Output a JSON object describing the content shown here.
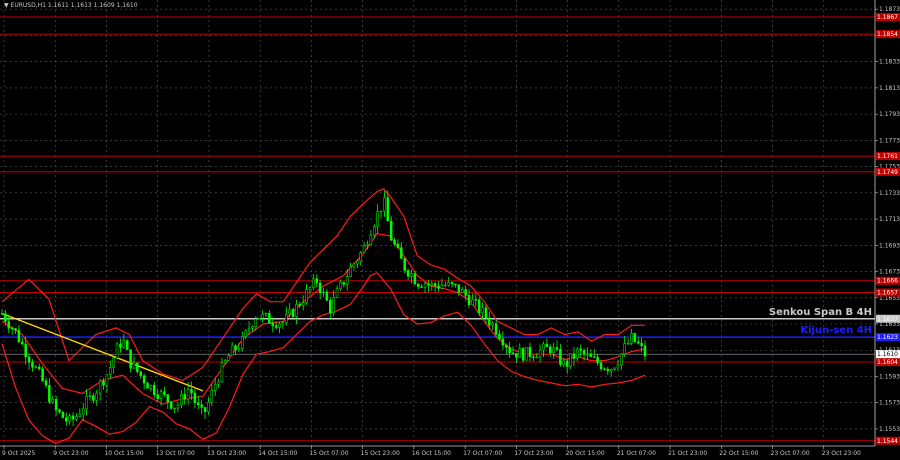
{
  "header": {
    "title": "▼ EURUSD,H1  1.1611 1.1613 1.1609 1.1610"
  },
  "colors": {
    "background": "#000000",
    "grid": "#5a5a5a",
    "candle": "#00ff00",
    "band": "#ff1a1a",
    "level": "#c00000",
    "senkou": "#c8c8c8",
    "kijun": "#1e1eff",
    "trend": "#ffd700",
    "price_line": "#c8c8c8"
  },
  "chart_data": {
    "type": "line",
    "symbol": "EURUSD",
    "timeframe": "H1",
    "ylim": [
      1.154,
      1.188
    ],
    "y_ticks": [
      "1.1873",
      "1.1853",
      "1.1833",
      "1.1813",
      "1.1793",
      "1.1773",
      "1.1753",
      "1.1733",
      "1.1713",
      "1.1693",
      "1.1673",
      "1.1653",
      "1.1633",
      "1.1613",
      "1.1593",
      "1.1573",
      "1.1553"
    ],
    "x_ticks": [
      "9 Oct 2025",
      "9 Oct 23:00",
      "10 Oct 15:00",
      "13 Oct 07:00",
      "13 Oct 23:00",
      "14 Oct 15:00",
      "15 Oct 07:00",
      "15 Oct 23:00",
      "16 Oct 15:00",
      "17 Oct 07:00",
      "17 Oct 23:00",
      "20 Oct 15:00",
      "21 Oct 07:00",
      "21 Oct 23:00",
      "22 Oct 15:00",
      "23 Oct 07:00",
      "23 Oct 23:00"
    ],
    "current_price": "1.1610",
    "legend": "none",
    "grid": true,
    "levels": [
      {
        "price": 1.1867,
        "label": "1.1867",
        "color": "#c00000"
      },
      {
        "price": 1.1854,
        "label": "1.1854",
        "color": "#c00000"
      },
      {
        "price": 1.1761,
        "label": "1.1761",
        "color": "#c00000"
      },
      {
        "price": 1.1749,
        "label": "1.1749",
        "color": "#c00000"
      },
      {
        "price": 1.1666,
        "label": "1.1666",
        "color": "#c00000"
      },
      {
        "price": 1.1657,
        "label": "1.1657",
        "color": "#c00000"
      },
      {
        "price": 1.1637,
        "label": "1.1637",
        "color": "#c8c8c8",
        "name": "Senkou Span B 4H"
      },
      {
        "price": 1.1623,
        "label": "1.1623",
        "color": "#1e1eff",
        "name": "Kijun-sen 4H"
      },
      {
        "price": 1.1604,
        "label": "1.1604",
        "color": "#c00000"
      },
      {
        "price": 1.1544,
        "label": "1.1544",
        "color": "#c00000"
      }
    ],
    "price_path": [
      [
        0,
        1.1641
      ],
      [
        2,
        1.1627
      ],
      [
        4,
        1.1608
      ],
      [
        6,
        1.159
      ],
      [
        8,
        1.1567
      ],
      [
        10,
        1.1558
      ],
      [
        11,
        1.1562
      ],
      [
        12,
        1.157
      ],
      [
        13,
        1.1575
      ],
      [
        14,
        1.1582
      ],
      [
        15,
        1.159
      ],
      [
        16,
        1.1598
      ],
      [
        17,
        1.1612
      ],
      [
        18,
        1.1622
      ],
      [
        19,
        1.1605
      ],
      [
        20,
        1.1598
      ],
      [
        21,
        1.1592
      ],
      [
        22,
        1.1586
      ],
      [
        24,
        1.1578
      ],
      [
        26,
        1.157
      ],
      [
        27,
        1.1577
      ],
      [
        28,
        1.1585
      ],
      [
        29,
        1.1571
      ],
      [
        30,
        1.1563
      ],
      [
        31,
        1.1575
      ],
      [
        32,
        1.159
      ],
      [
        34,
        1.161
      ],
      [
        36,
        1.162
      ],
      [
        37,
        1.1632
      ],
      [
        38,
        1.164
      ],
      [
        40,
        1.1636
      ],
      [
        42,
        1.1634
      ],
      [
        44,
        1.1646
      ],
      [
        46,
        1.166
      ],
      [
        47,
        1.1666
      ],
      [
        48,
        1.1655
      ],
      [
        49,
        1.1645
      ],
      [
        50,
        1.1656
      ],
      [
        52,
        1.1675
      ],
      [
        54,
        1.169
      ],
      [
        55,
        1.1705
      ],
      [
        56,
        1.1716
      ],
      [
        57,
        1.1727
      ],
      [
        58,
        1.17
      ],
      [
        59,
        1.1688
      ],
      [
        60,
        1.1677
      ],
      [
        61,
        1.1672
      ],
      [
        62,
        1.1665
      ],
      [
        63,
        1.1665
      ],
      [
        64,
        1.1662
      ],
      [
        66,
        1.1663
      ],
      [
        68,
        1.166
      ],
      [
        69,
        1.1656
      ],
      [
        70,
        1.1651
      ],
      [
        72,
        1.164
      ],
      [
        74,
        1.1628
      ],
      [
        76,
        1.1612
      ],
      [
        78,
        1.161
      ],
      [
        80,
        1.1612
      ],
      [
        82,
        1.1615
      ],
      [
        84,
        1.1601
      ],
      [
        86,
        1.1612
      ],
      [
        88,
        1.1606
      ],
      [
        90,
        1.1601
      ],
      [
        91,
        1.16
      ],
      [
        92,
        1.1606
      ],
      [
        93,
        1.1615
      ],
      [
        94,
        1.1622
      ],
      [
        95,
        1.1617
      ],
      [
        96,
        1.161
      ]
    ],
    "band_upper": [
      [
        0,
        1.165
      ],
      [
        4,
        1.1667
      ],
      [
        7,
        1.1652
      ],
      [
        10,
        1.1605
      ],
      [
        14,
        1.1625
      ],
      [
        17,
        1.163
      ],
      [
        19,
        1.1625
      ],
      [
        21,
        1.1605
      ],
      [
        24,
        1.1595
      ],
      [
        27,
        1.159
      ],
      [
        30,
        1.16
      ],
      [
        32,
        1.1615
      ],
      [
        34,
        1.163
      ],
      [
        36,
        1.1645
      ],
      [
        38,
        1.1656
      ],
      [
        40,
        1.165
      ],
      [
        42,
        1.165
      ],
      [
        44,
        1.1665
      ],
      [
        46,
        1.168
      ],
      [
        48,
        1.169
      ],
      [
        50,
        1.17
      ],
      [
        52,
        1.1715
      ],
      [
        54,
        1.1725
      ],
      [
        56,
        1.1734
      ],
      [
        57,
        1.1736
      ],
      [
        58,
        1.173
      ],
      [
        60,
        1.1715
      ],
      [
        62,
        1.1685
      ],
      [
        64,
        1.1678
      ],
      [
        66,
        1.1675
      ],
      [
        68,
        1.1668
      ],
      [
        70,
        1.1662
      ],
      [
        72,
        1.165
      ],
      [
        74,
        1.1635
      ],
      [
        76,
        1.163
      ],
      [
        78,
        1.1625
      ],
      [
        80,
        1.1625
      ],
      [
        82,
        1.163
      ],
      [
        84,
        1.1625
      ],
      [
        86,
        1.1627
      ],
      [
        88,
        1.162
      ],
      [
        90,
        1.1625
      ],
      [
        92,
        1.1625
      ],
      [
        94,
        1.1632
      ],
      [
        96,
        1.1632
      ]
    ],
    "band_lower": [
      [
        0,
        1.1618
      ],
      [
        2,
        1.1585
      ],
      [
        4,
        1.156
      ],
      [
        6,
        1.1548
      ],
      [
        8,
        1.1542
      ],
      [
        10,
        1.1546
      ],
      [
        12,
        1.156
      ],
      [
        14,
        1.1555
      ],
      [
        16,
        1.1549
      ],
      [
        18,
        1.1551
      ],
      [
        20,
        1.1558
      ],
      [
        22,
        1.157
      ],
      [
        24,
        1.1566
      ],
      [
        26,
        1.1557
      ],
      [
        28,
        1.1553
      ],
      [
        30,
        1.1545
      ],
      [
        32,
        1.155
      ],
      [
        34,
        1.157
      ],
      [
        36,
        1.1595
      ],
      [
        38,
        1.161
      ],
      [
        40,
        1.1612
      ],
      [
        42,
        1.1615
      ],
      [
        44,
        1.1625
      ],
      [
        46,
        1.1635
      ],
      [
        48,
        1.164
      ],
      [
        50,
        1.1643
      ],
      [
        52,
        1.1648
      ],
      [
        54,
        1.1662
      ],
      [
        55,
        1.167
      ],
      [
        56,
        1.1672
      ],
      [
        58,
        1.166
      ],
      [
        60,
        1.164
      ],
      [
        62,
        1.1633
      ],
      [
        64,
        1.1634
      ],
      [
        66,
        1.1639
      ],
      [
        68,
        1.1642
      ],
      [
        70,
        1.1632
      ],
      [
        72,
        1.1618
      ],
      [
        74,
        1.1605
      ],
      [
        76,
        1.1597
      ],
      [
        78,
        1.1593
      ],
      [
        80,
        1.159
      ],
      [
        82,
        1.1588
      ],
      [
        84,
        1.1586
      ],
      [
        86,
        1.1587
      ],
      [
        88,
        1.1585
      ],
      [
        90,
        1.1587
      ],
      [
        92,
        1.1588
      ],
      [
        94,
        1.159
      ],
      [
        96,
        1.1594
      ]
    ],
    "band_mid": [
      [
        0,
        1.1635
      ],
      [
        3,
        1.1625
      ],
      [
        6,
        1.1603
      ],
      [
        9,
        1.1584
      ],
      [
        12,
        1.158
      ],
      [
        15,
        1.159
      ],
      [
        18,
        1.1594
      ],
      [
        21,
        1.158
      ],
      [
        24,
        1.1572
      ],
      [
        27,
        1.1576
      ],
      [
        30,
        1.1578
      ],
      [
        33,
        1.16
      ],
      [
        36,
        1.1622
      ],
      [
        39,
        1.1633
      ],
      [
        42,
        1.1635
      ],
      [
        45,
        1.165
      ],
      [
        48,
        1.1662
      ],
      [
        51,
        1.167
      ],
      [
        54,
        1.1687
      ],
      [
        56,
        1.1702
      ],
      [
        58,
        1.17
      ],
      [
        60,
        1.1685
      ],
      [
        62,
        1.167
      ],
      [
        64,
        1.1662
      ],
      [
        66,
        1.166
      ],
      [
        68,
        1.1657
      ],
      [
        70,
        1.165
      ],
      [
        72,
        1.1635
      ],
      [
        74,
        1.1622
      ],
      [
        76,
        1.1614
      ],
      [
        78,
        1.161
      ],
      [
        80,
        1.161
      ],
      [
        82,
        1.161
      ],
      [
        84,
        1.1606
      ],
      [
        86,
        1.1608
      ],
      [
        88,
        1.1605
      ],
      [
        90,
        1.1605
      ],
      [
        92,
        1.1608
      ],
      [
        94,
        1.1612
      ],
      [
        96,
        1.1614
      ]
    ],
    "trend_line": [
      [
        0,
        1.1641
      ],
      [
        30,
        1.1582
      ]
    ]
  }
}
